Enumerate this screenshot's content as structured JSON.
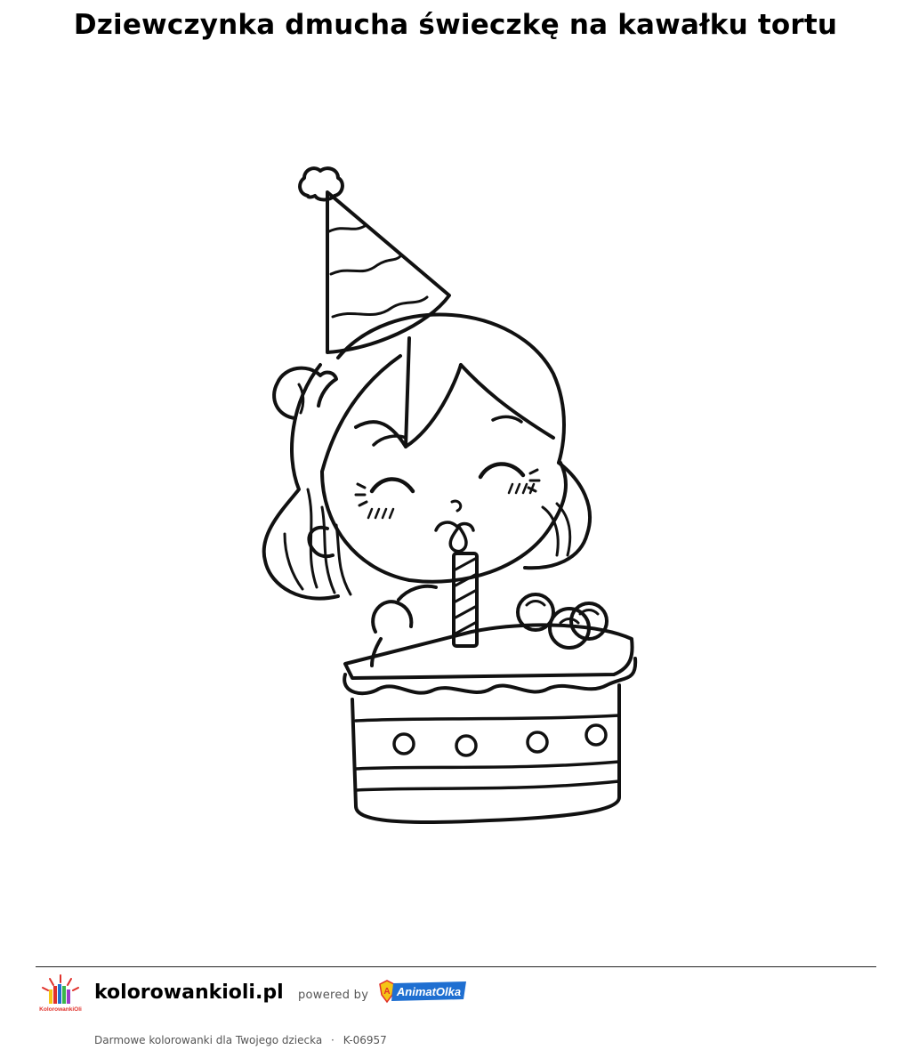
{
  "page": {
    "title": "Dziewczynka dmucha świeczkę na kawałku tortu"
  },
  "artwork": {
    "icon": "girl-blowing-candle-on-cake-illustration"
  },
  "footer": {
    "site_name": "kolorowankioli.pl",
    "powered_by": "powered by",
    "partner_logo_text": "AnimatOlka",
    "site_logo_text": "KolorowankiOli",
    "tagline": "Darmowe kolorowanki dla Twojego dziecka",
    "separator": "·",
    "code": "K-06957"
  },
  "colors": {
    "line_art": "#111111",
    "partner_blue": "#1f6fd1",
    "partner_red": "#e0302a",
    "partner_yellow": "#f5c516"
  }
}
